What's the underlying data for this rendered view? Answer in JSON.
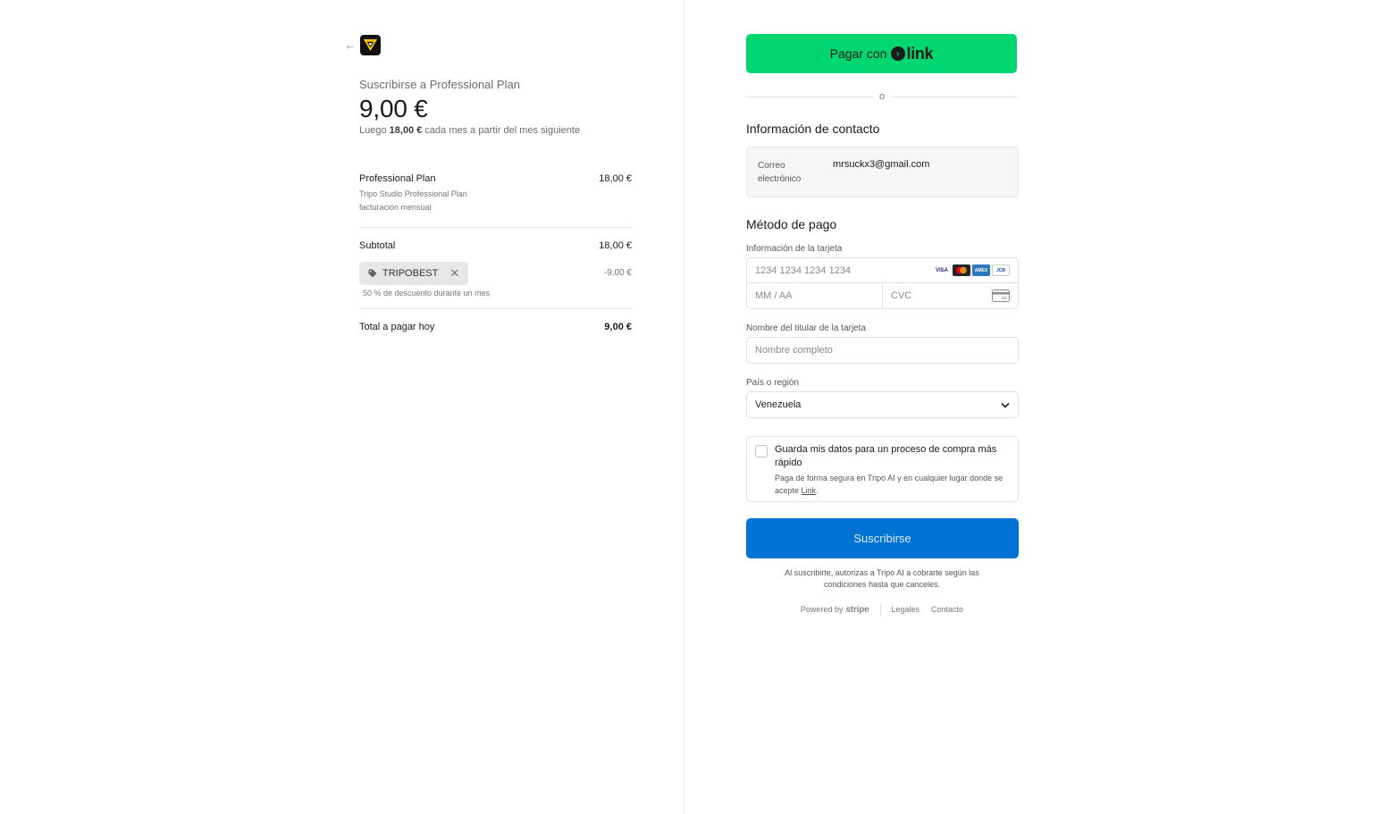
{
  "summary": {
    "subscribe_title": "Suscribirse a Professional Plan",
    "price": "9,00 €",
    "then_prefix": "Luego",
    "then_amount": "18,00 €",
    "then_suffix": "cada mes a partir del mes siguiente",
    "item": {
      "name": "Professional Plan",
      "desc1": "Tripo Studio Professional Plan",
      "desc2": "facturación mensual",
      "amount": "18,00 €"
    },
    "subtotal_label": "Subtotal",
    "subtotal_amount": "18,00 €",
    "coupon_code": "TRIPOBEST",
    "coupon_amount": "-9,00 €",
    "coupon_note": "50 % de descuento durante un mes",
    "total_label": "Total a pagar hoy",
    "total_amount": "9,00 €"
  },
  "checkout": {
    "link_button_prefix": "Pagar con",
    "link_brand": "link",
    "or_text": "o",
    "contact_heading": "Información de contacto",
    "email_label": "Correo electrónico",
    "email_value": "mrsuckx3@gmail.com",
    "payment_heading": "Método de pago",
    "card_label": "Información de la tarjeta",
    "card_number_placeholder": "1234 1234 1234 1234",
    "expiry_placeholder": "MM / AA",
    "cvc_placeholder": "CVC",
    "card_brands": [
      "VISA",
      "MC",
      "AMEX",
      "JCB"
    ],
    "name_label": "Nombre del titular de la tarjeta",
    "name_placeholder": "Nombre completo",
    "country_label": "País o región",
    "country_value": "Venezuela",
    "save_title": "Guarda mis datos para un proceso de compra más rápido",
    "save_desc_prefix": "Paga de forma segura en Tripo AI y en cualquier lugar donde se acepte",
    "save_desc_link": "Link",
    "save_desc_suffix": ".",
    "subscribe_button": "Suscribirse",
    "legal_text": "Al suscribirte, autorizas a Tripo AI a cobrarte según las condiciones hasta que canceles.",
    "powered_by": "Powered by",
    "stripe": "stripe",
    "footer_links": [
      "Legales",
      "Contacto"
    ]
  },
  "colors": {
    "link_green": "#00d66f",
    "subscribe_blue": "#0074d4"
  }
}
